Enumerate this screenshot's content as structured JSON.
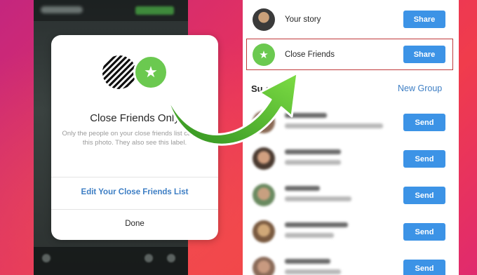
{
  "left_modal": {
    "title": "Close Friends Only",
    "body": "Only the people on your close friends list can see this photo. They also see this label.",
    "edit_link": "Edit Your Close Friends List",
    "done_label": "Done",
    "star_icon": "★"
  },
  "share_list": {
    "your_story": {
      "label": "Your story",
      "button": "Share"
    },
    "close_friends": {
      "label": "Close Friends",
      "button": "Share",
      "icon": "★"
    },
    "section_label": "Su        ed",
    "new_group": "New Group",
    "send_label": "Send"
  },
  "colors": {
    "accent_blue": "#3c93e6",
    "close_green": "#6bc950",
    "highlight_red": "#c0393b",
    "arrow_green": "#5fc43a"
  }
}
